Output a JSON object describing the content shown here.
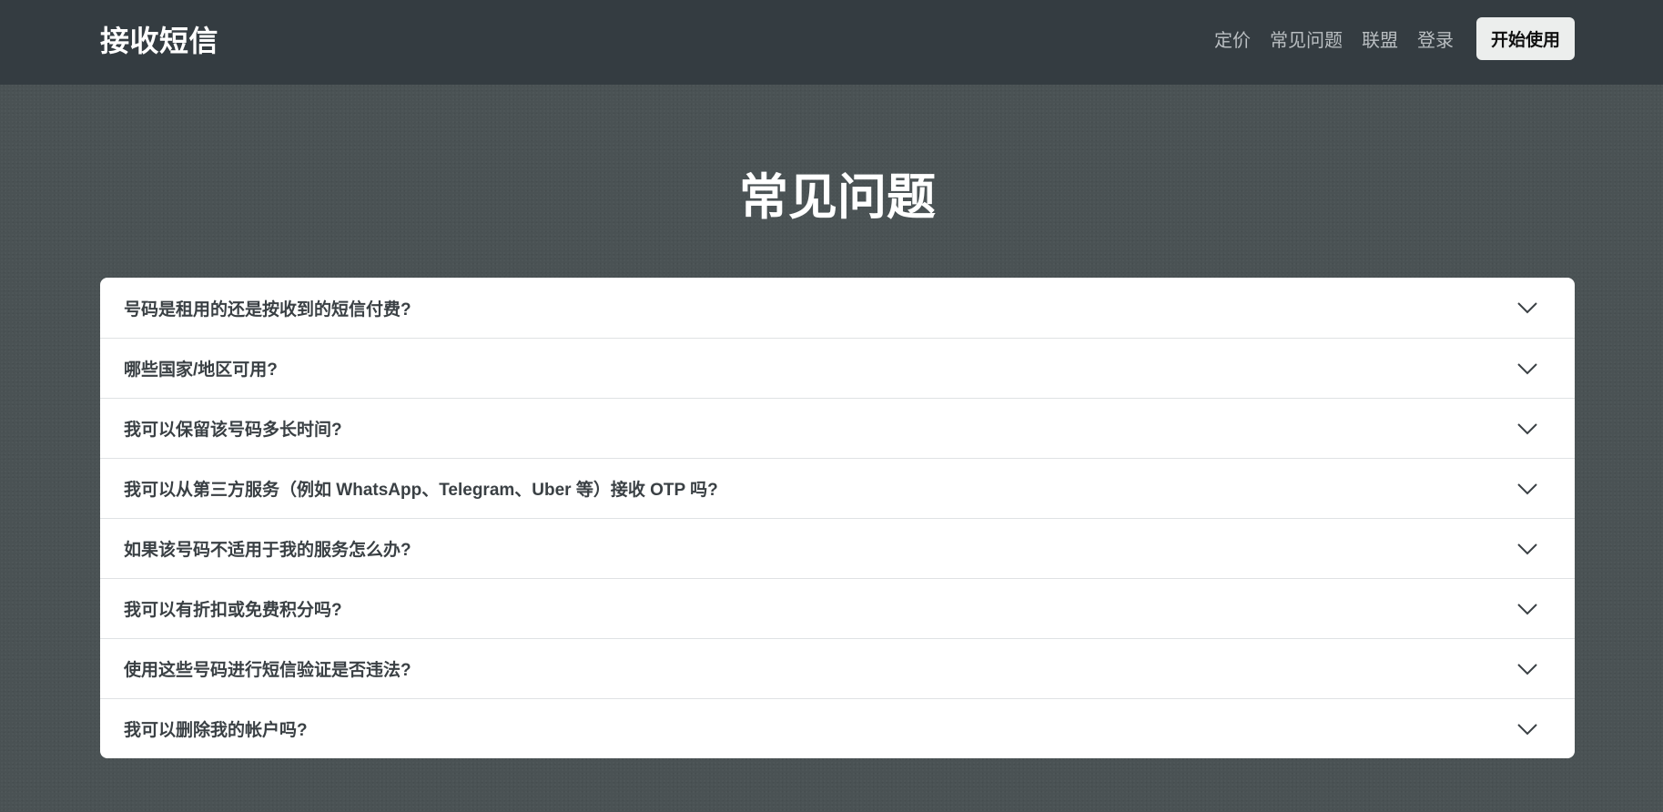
{
  "header": {
    "brand": "接收短信",
    "nav": [
      "定价",
      "常见问题",
      "联盟",
      "登录"
    ],
    "cta_label": "开始使用"
  },
  "main": {
    "title": "常见问题",
    "faq_items": [
      "号码是租用的还是按收到的短信付费?",
      "哪些国家/地区可用?",
      "我可以保留该号码多长时间?",
      "我可以从第三方服务（例如 WhatsApp、Telegram、Uber 等）接收 OTP 吗?",
      "如果该号码不适用于我的服务怎么办?",
      "我可以有折扣或免费积分吗?",
      "使用这些号码进行短信验证是否违法?",
      "我可以删除我的帐户吗?"
    ],
    "expand_icon": "chevron-down-icon"
  },
  "colors": {
    "page_background": "#4a5254",
    "navbar_background": "#343c41",
    "cta_background": "#eceeed",
    "card_background": "#ffffff",
    "question_text": "#3a4044"
  }
}
